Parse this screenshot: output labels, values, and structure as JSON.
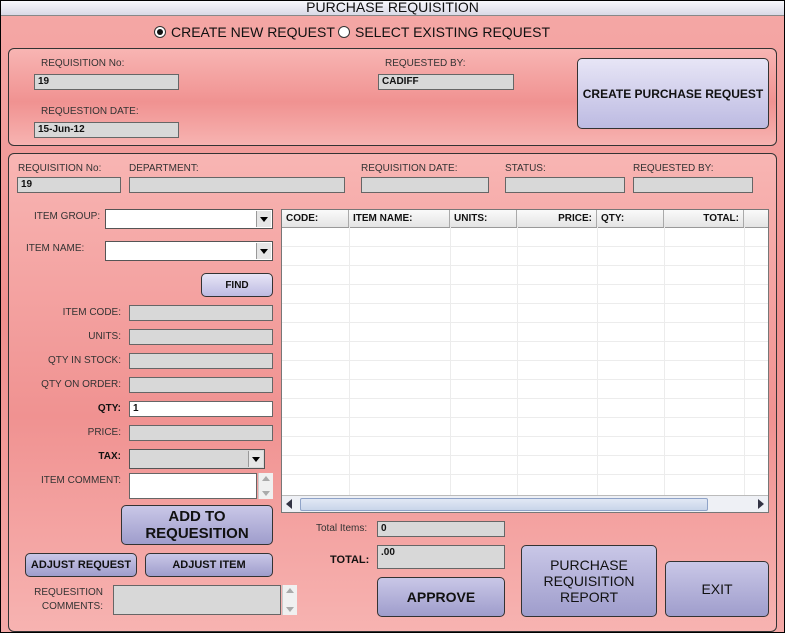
{
  "title": "PURCHASE REQUISITION",
  "mode": {
    "create_new": "CREATE NEW REQUEST",
    "select_existing": "SELECT EXISTING REQUEST"
  },
  "header": {
    "req_no_label": "REQUISITION No:",
    "req_no_value": "19",
    "req_date_label": "REQUESTION DATE:",
    "req_date_value": "15-Jun-12",
    "requested_by_label": "REQUESTED BY:",
    "requested_by_value": "CADIFF",
    "create_button": "CREATE PURCHASE REQUEST"
  },
  "detail": {
    "req_no_label": "REQUISITION No:",
    "req_no_value": "19",
    "department_label": "DEPARTMENT:",
    "department_value": "",
    "req_date_label": "REQUISITION  DATE:",
    "req_date_value": "",
    "status_label": "STATUS:",
    "status_value": "",
    "requested_by_label": "REQUESTED BY:",
    "requested_by_value": ""
  },
  "item_form": {
    "item_group_label": "ITEM GROUP:",
    "item_name_label": "ITEM NAME:",
    "find_button": "FIND",
    "item_code_label": "ITEM CODE:",
    "units_label": "UNITS:",
    "qty_in_stock_label": "QTY IN STOCK:",
    "qty_on_order_label": "QTY ON ORDER:",
    "qty_label": "QTY:",
    "qty_value": "1",
    "price_label": "PRICE:",
    "tax_label": "TAX:",
    "item_comment_label": "ITEM COMMENT:",
    "add_button": "ADD TO REQUESITION",
    "adjust_request_button": "ADJUST REQUEST",
    "adjust_item_button": "ADJUST ITEM",
    "comments_label": "REQUESITION COMMENTS:"
  },
  "table": {
    "columns": [
      "CODE:",
      "ITEM NAME:",
      "UNITS:",
      "PRICE:",
      "QTY:",
      "TOTAL:"
    ]
  },
  "totals": {
    "total_items_label": "Total Items:",
    "total_items_value": "0",
    "total_label": "TOTAL:",
    "total_value": ".00"
  },
  "actions": {
    "approve": "APPROVE",
    "report": "PURCHASE REQUISITION REPORT",
    "exit": "EXIT"
  }
}
